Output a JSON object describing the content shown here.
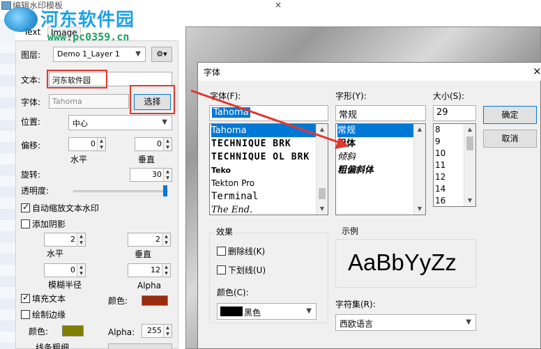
{
  "window": {
    "title": "编辑水印模板",
    "close_glyph": "×"
  },
  "watermark": {
    "site_name": "河东软件园",
    "site_url": "www.pc0359.cn"
  },
  "tabs": [
    {
      "label": "Text"
    },
    {
      "label": "Image"
    }
  ],
  "panel": {
    "layer_label": "图层:",
    "layer_value": "Demo 1_Layer 1",
    "text_label": "文本:",
    "text_value": "河东软件园",
    "font_label": "字体:",
    "font_value": "Tahoma",
    "choose_button": "选择",
    "position_label": "位置:",
    "position_value": "中心",
    "offset_label": "偏移:",
    "offset_h_value": "0",
    "offset_v_value": "0",
    "horizontal_label": "水平",
    "vertical_label": "垂直",
    "rotate_label": "旋转:",
    "rotate_value": "30",
    "opacity_label": "透明度:",
    "opacity_fraction": 0.97,
    "auto_scale_label": "自动缩放文本水印",
    "auto_scale_checked": true,
    "shadow_label": "添加阴影",
    "shadow_checked": false,
    "shadow_h_value": "2",
    "shadow_v_value": "2",
    "shadow_h_label": "水平",
    "shadow_v_label": "垂直",
    "blur_value": "0",
    "alpha_value": "12",
    "blur_label": "模糊半径",
    "alpha_label": "Alpha",
    "fill_text_label": "填充文本",
    "fill_text_checked": true,
    "fill_color_label": "颜色:",
    "fill_color": "#9a2a0d",
    "stroke_label": "绘制边缘",
    "stroke_checked": false,
    "stroke_color_label": "颜色:",
    "stroke_color": "#7f7f00",
    "stroke_alpha_label": "Alpha:",
    "stroke_alpha_value": "255",
    "line_width_label": "线条粗细"
  },
  "font_dialog": {
    "title": "字体",
    "close_glyph": "×",
    "font_label": "字体(F):",
    "font_input": "Tahoma",
    "fonts": [
      "Tahoma",
      "TECHNIQUE BRK",
      "TECHNIQUE OL BRK",
      "Teko",
      "Tekton Pro",
      "Terminal",
      "The End."
    ],
    "style_label": "字形(Y):",
    "style_input": "常规",
    "styles": [
      "常规",
      "粗体",
      "倾斜",
      "粗偏斜体"
    ],
    "size_label": "大小(S):",
    "size_input": "29",
    "sizes": [
      "8",
      "9",
      "10",
      "11",
      "12",
      "14",
      "16"
    ],
    "ok_button": "确定",
    "cancel_button": "取消",
    "effects_label": "效果",
    "strikeout_label": "删除线(K)",
    "underline_label": "下划线(U)",
    "color_label": "颜色(C):",
    "color_value": "黑色",
    "color_swatch": "#000000",
    "sample_label": "示例",
    "sample_text": "AaBbYyZz",
    "script_label": "字符集(R):",
    "script_value": "西欧语言"
  },
  "colors": {
    "accent": "#0078d7",
    "highlight_red": "#e5352c"
  }
}
